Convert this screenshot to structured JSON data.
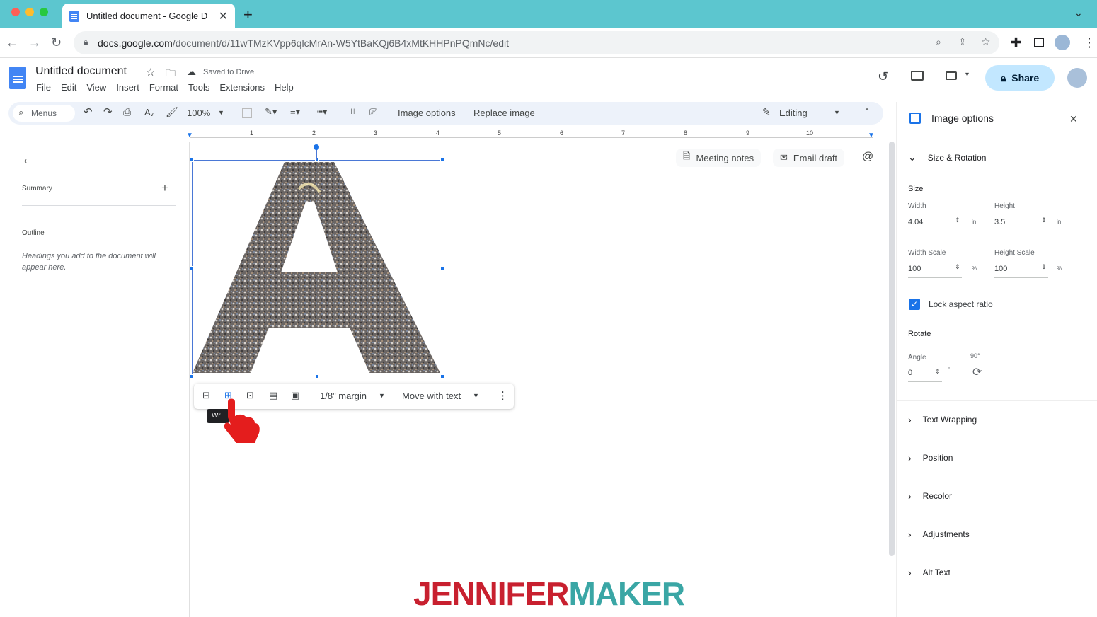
{
  "browser": {
    "tab_title": "Untitled document - Google D",
    "url_host": "docs.google.com",
    "url_path": "/document/d/11wTMzKVpp6qlcMrAn-W5YtBaKQj6B4xMtKHHPnPQmNc/edit"
  },
  "doc": {
    "title": "Untitled document",
    "save_status": "Saved to Drive",
    "menu": [
      "File",
      "Edit",
      "View",
      "Insert",
      "Format",
      "Tools",
      "Extensions",
      "Help"
    ],
    "share_label": "Share"
  },
  "toolbar": {
    "search_placeholder": "Menus",
    "zoom": "100%",
    "image_options": "Image options",
    "replace_image": "Replace image",
    "mode": "Editing"
  },
  "ruler_ticks": [
    "1",
    "2",
    "3",
    "4",
    "5",
    "6",
    "7",
    "8",
    "9",
    "10"
  ],
  "left_panel": {
    "summary": "Summary",
    "outline": "Outline",
    "outline_hint": "Headings you add to the document will appear here."
  },
  "chips": {
    "meeting_notes": "Meeting notes",
    "email_draft": "Email draft"
  },
  "image_toolbar": {
    "margin": "1/8\" margin",
    "position": "Move with text",
    "tooltip": "Wr"
  },
  "side_panel": {
    "title": "Image options",
    "size_rotation": "Size & Rotation",
    "size": "Size",
    "width_label": "Width",
    "width": "4.04",
    "height_label": "Height",
    "height": "3.5",
    "unit": "in",
    "width_scale_label": "Width Scale",
    "width_scale": "100",
    "height_scale_label": "Height Scale",
    "height_scale": "100",
    "percent": "%",
    "lock_aspect": "Lock aspect ratio",
    "lock_checked": true,
    "rotate": "Rotate",
    "angle_label": "Angle",
    "angle": "0",
    "degree": "°",
    "rotate_90": "90°",
    "sections": [
      "Text Wrapping",
      "Position",
      "Recolor",
      "Adjustments",
      "Alt Text"
    ]
  },
  "watermark": {
    "part1": "JENNIFER",
    "part2": "MAKER",
    "color1": "#c8202f",
    "color2": "#3aa6a5"
  },
  "colors": {
    "tabbar": "#5cc6cf",
    "accent": "#1a73e8",
    "share_bg": "#c2e7ff"
  }
}
